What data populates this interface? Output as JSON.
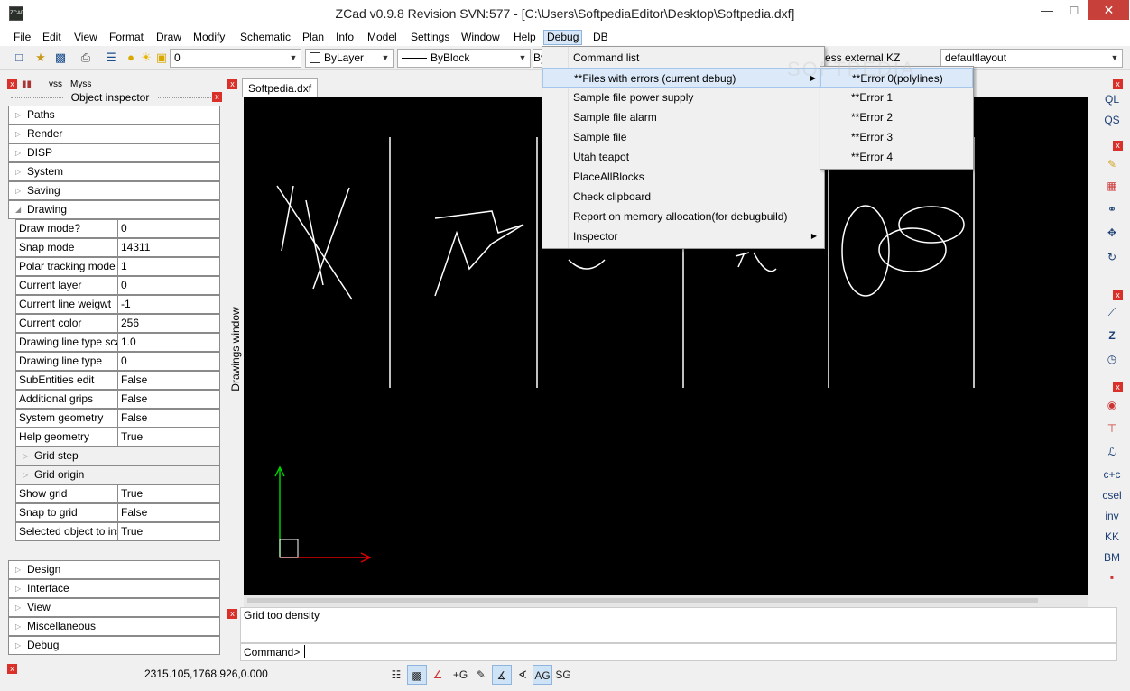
{
  "window": {
    "title": "ZCad v0.9.8 Revision SVN:577 - [C:\\Users\\SoftpediaEditor\\Desktop\\Softpedia.dxf]",
    "icon_text": "ZCAD"
  },
  "menubar": [
    "File",
    "Edit",
    "View",
    "Format",
    "Draw",
    "Modify",
    "Schematic",
    "Plan",
    "Info",
    "Model",
    "Settings",
    "Window",
    "Help",
    "Debug",
    "DB"
  ],
  "toolbar": {
    "layer": "0",
    "color": "ByLayer",
    "linetype": "ByBlock",
    "linetype2": "By",
    "extra": "ess external KZ",
    "layout": "defaultlayout"
  },
  "left_panel": {
    "title": "Object inspector",
    "partial_labels": [
      "vss",
      "Myss"
    ],
    "categories_top": [
      "Paths",
      "Render",
      "DISP",
      "System",
      "Saving",
      "Drawing"
    ],
    "properties": [
      {
        "k": "Draw mode?",
        "v": "0"
      },
      {
        "k": "Snap mode",
        "v": "14311"
      },
      {
        "k": "Polar tracking mode",
        "v": "1"
      },
      {
        "k": "Current layer",
        "v": "0"
      },
      {
        "k": "Current line weigwt",
        "v": "-1"
      },
      {
        "k": "Current color",
        "v": "256"
      },
      {
        "k": "Drawing line type sca",
        "v": "1.0"
      },
      {
        "k": "Drawing line type",
        "v": "0"
      },
      {
        "k": "SubEntities edit",
        "v": "False"
      },
      {
        "k": "Additional grips",
        "v": "False"
      },
      {
        "k": "System geometry",
        "v": "False"
      },
      {
        "k": "Help geometry",
        "v": "True"
      }
    ],
    "subcats": [
      "Grid step",
      "Grid origin"
    ],
    "properties2": [
      {
        "k": "Show grid",
        "v": "True"
      },
      {
        "k": "Snap to grid",
        "v": "False"
      },
      {
        "k": "Selected object to ins",
        "v": "True"
      }
    ],
    "categories_bottom": [
      "Design",
      "Interface",
      "View",
      "Miscellaneous",
      "Debug"
    ]
  },
  "drawings_window_label": "Drawings window",
  "doc_tab": "Softpedia.dxf",
  "right_buttons": [
    "QL",
    "QS",
    "c+c",
    "csel",
    "inv",
    "KK",
    "BM"
  ],
  "command": {
    "message": "Grid too density",
    "prompt": "Command>"
  },
  "status": {
    "coords": "2315.105,1768.926,0.000",
    "plus_g": "+G",
    "ag": "AG",
    "sg": "SG"
  },
  "debug_menu": {
    "items": [
      "Command list",
      "**Files with errors (current debug)",
      "Sample file power supply",
      "Sample file alarm",
      "Sample file",
      "Utah teapot",
      "PlaceAllBlocks",
      "Check clipboard",
      "Report on memory allocation(for debugbuild)",
      "Inspector"
    ],
    "submenu": [
      "**Error 0(polylines)",
      "**Error 1",
      "**Error 2",
      "**Error 3",
      "**Error 4"
    ]
  },
  "watermark": "SOFTPEDIA",
  "colors": {
    "canvas": "#000000",
    "highlight": "#dbe9f8",
    "close": "#c7403a"
  }
}
